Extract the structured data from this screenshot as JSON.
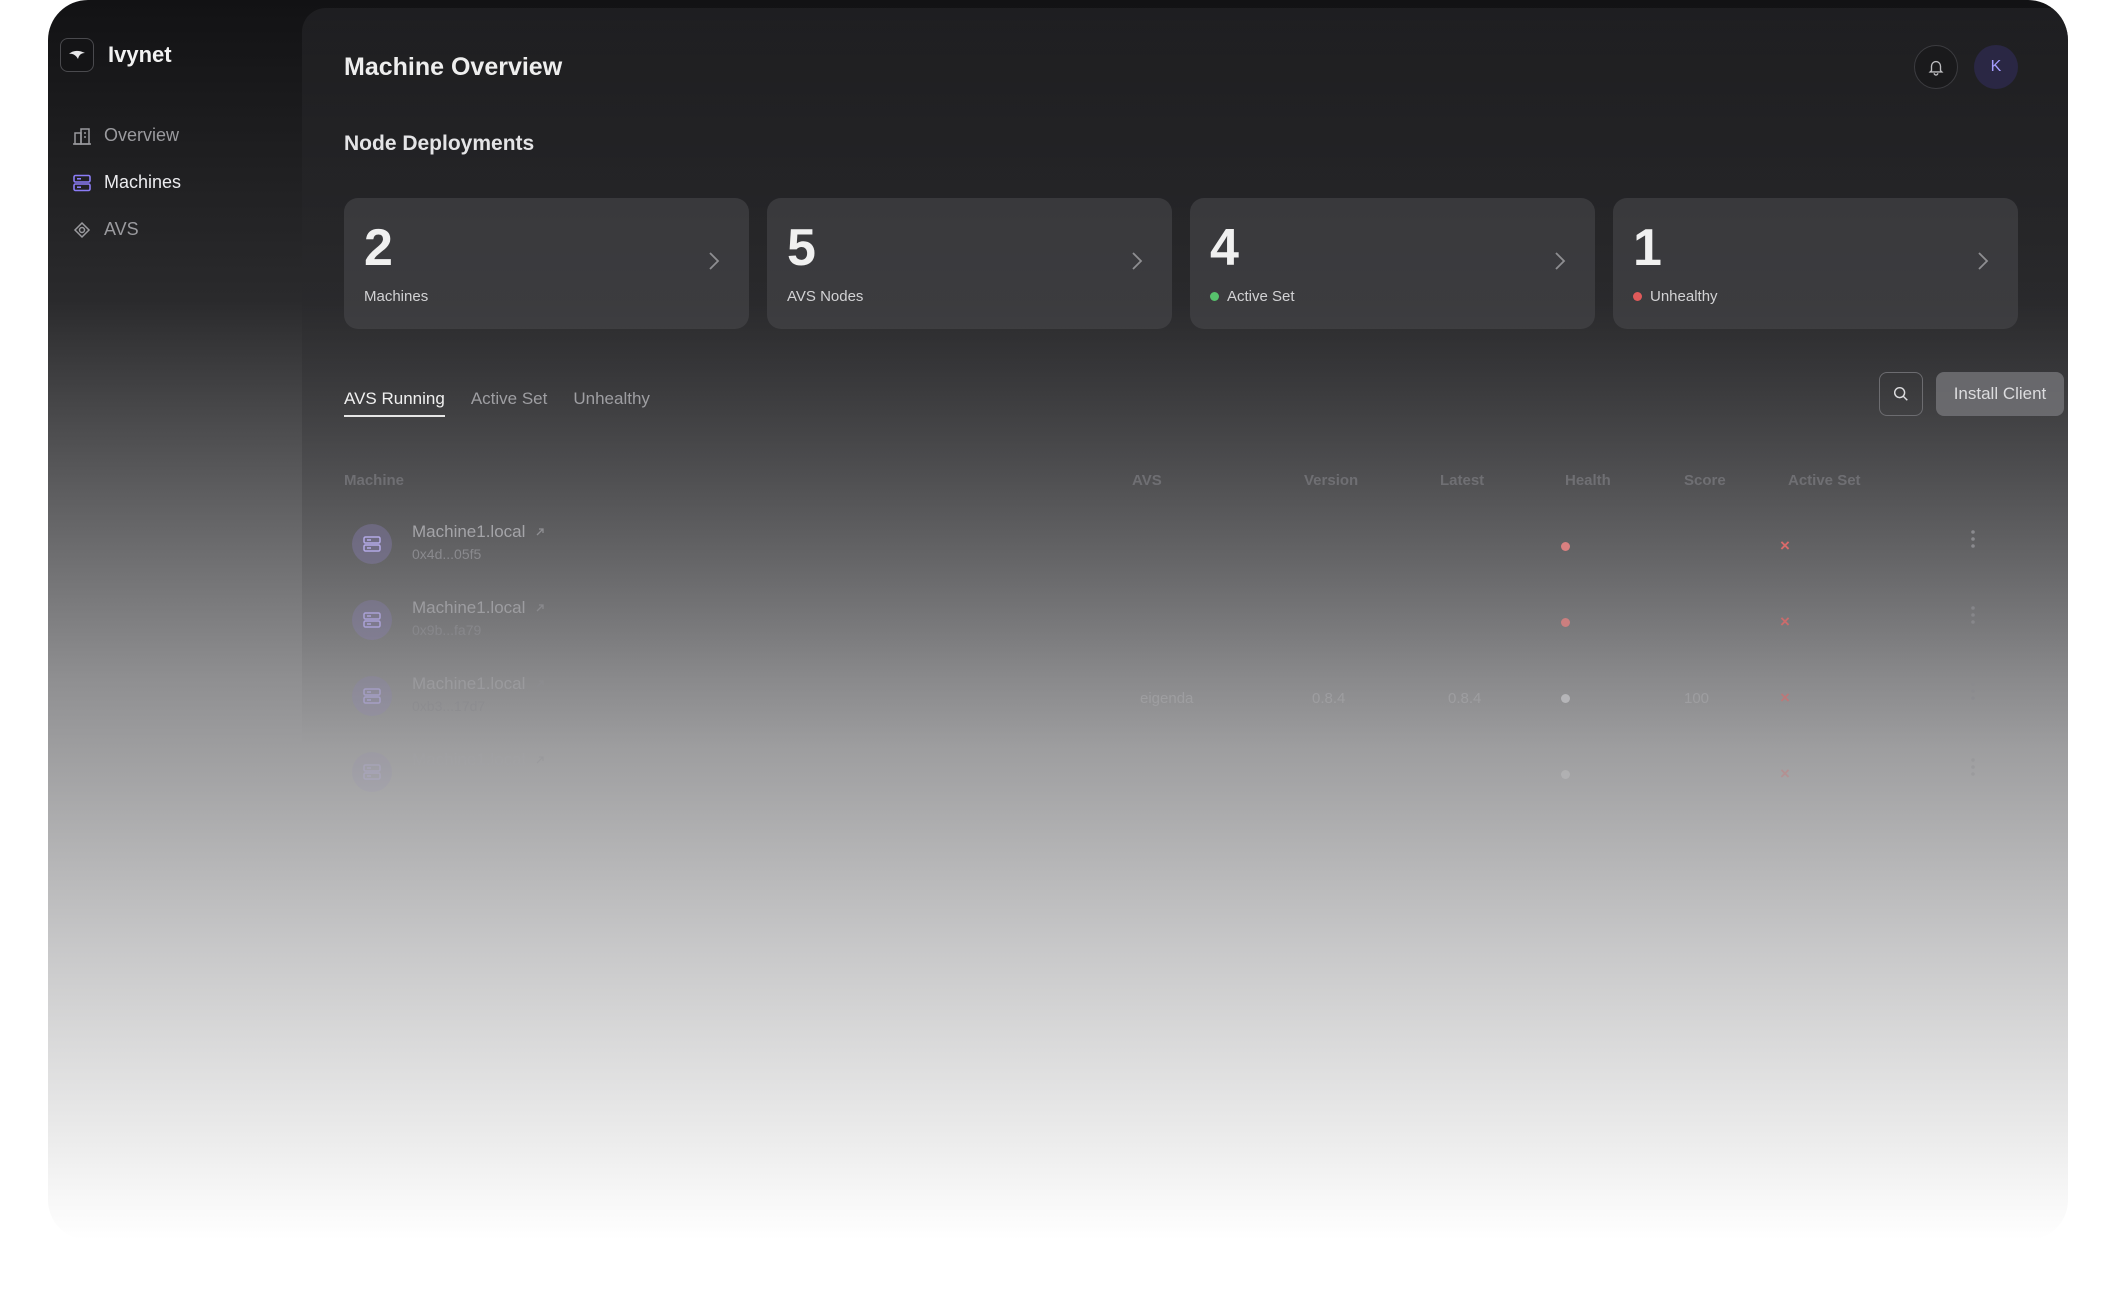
{
  "brand": {
    "name": "Ivynet",
    "logo_icon": "ivynet-logo-icon"
  },
  "sidebar": {
    "items": [
      {
        "label": "Overview",
        "icon": "building-icon",
        "active": false
      },
      {
        "label": "Machines",
        "icon": "server-icon",
        "active": true
      },
      {
        "label": "AVS",
        "icon": "avs-icon",
        "active": false
      }
    ]
  },
  "header": {
    "title": "Machine Overview",
    "avatar_initial": "K"
  },
  "deployments": {
    "title": "Node Deployments",
    "cards": [
      {
        "value": "2",
        "label": "Machines",
        "dot": null
      },
      {
        "value": "5",
        "label": "AVS Nodes",
        "dot": null
      },
      {
        "value": "4",
        "label": "Active Set",
        "dot": "#57c26c"
      },
      {
        "value": "1",
        "label": "Unhealthy",
        "dot": "#e05a5a"
      }
    ]
  },
  "tabs": [
    {
      "label": "AVS Running",
      "active": true
    },
    {
      "label": "Active Set",
      "active": false
    },
    {
      "label": "Unhealthy",
      "active": false
    }
  ],
  "actions": {
    "install_label": "Install Client"
  },
  "table": {
    "headers": {
      "machine": "Machine",
      "avs": "AVS",
      "version": "Version",
      "latest": "Latest",
      "health": "Health",
      "score": "Score",
      "active_set": "Active Set"
    },
    "rows": [
      {
        "name": "Machine1.local",
        "address": "0x4d...05f5",
        "avs": "",
        "version": "",
        "latest": "",
        "health_color": "#d98080",
        "score": "",
        "active_set": "×",
        "opacity": 1.0
      },
      {
        "name": "Machine1.local",
        "address": "0x9b...fa79",
        "avs": "",
        "version": "",
        "latest": "",
        "health_color": "#d98080",
        "score": "",
        "active_set": "×",
        "opacity": 0.85
      },
      {
        "name": "Machine1.local",
        "address": "0xb3...17d7",
        "avs": "eigenda",
        "version": "0.8.4",
        "latest": "0.8.4",
        "health_color": "#cfcfd2",
        "score": "100",
        "active_set": "×",
        "opacity": 0.6
      },
      {
        "name": "Machine1.local",
        "address": "",
        "avs": "",
        "version": "",
        "latest": "",
        "health_color": "#cfcfd2",
        "score": "",
        "active_set": "×",
        "opacity": 0.3
      }
    ]
  },
  "colors": {
    "accent": "#8b7cf6",
    "danger": "#e05a5a",
    "success": "#57c26c"
  }
}
